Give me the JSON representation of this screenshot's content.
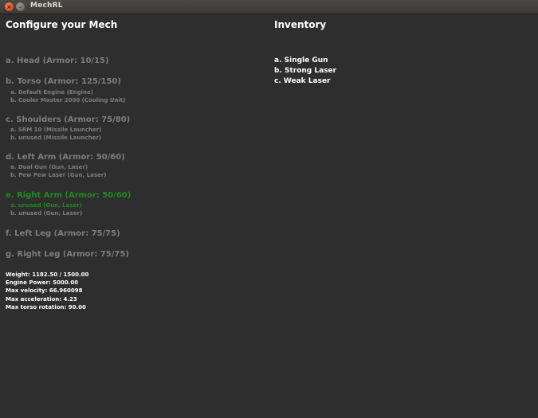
{
  "window": {
    "title": "MechRL",
    "close_glyph": "×",
    "minimize_glyph": "–"
  },
  "config": {
    "heading": "Configure your Mech",
    "parts": [
      {
        "label": "a. Head (Armor: 10/15)",
        "slots": []
      },
      {
        "label": "b. Torso (Armor: 125/150)",
        "slots": [
          "a. Default Engine (Engine)",
          "b. Cooler Master 2000 (Cooling Unit)"
        ]
      },
      {
        "label": "c. Shoulders (Armor: 75/80)",
        "slots": [
          "a. SRM 10 (Missile Launcher)",
          "b. unused (Missile Launcher)"
        ]
      },
      {
        "label": "d. Left Arm (Armor: 50/60)",
        "slots": [
          "a. Dual Gun (Gun, Laser)",
          "b. Pew Pew Laser (Gun, Laser)"
        ]
      },
      {
        "label": "e. Right Arm (Armor: 50/60)",
        "slots": [
          "a. unused (Gun, Laser)",
          "b. unused (Gun, Laser)"
        ]
      },
      {
        "label": "f. Left Leg (Armor: 75/75)",
        "slots": []
      },
      {
        "label": "g. Right Leg (Armor: 75/75)",
        "slots": []
      }
    ],
    "stats": [
      "Weight: 1182.50 / 1500.00",
      "Engine Power: 5000.00",
      "Max velocity: 66.960098",
      "Max acceleration: 4.23",
      "Max torso rotation: 90.00"
    ]
  },
  "inventory": {
    "heading": "Inventory",
    "items": [
      "a. Single Gun",
      "b. Strong Laser",
      "c. Weak Laser"
    ]
  },
  "colors": {
    "background": "#2e2e2e",
    "text_active": "#ffffff",
    "text_dim": "#7d7d7d",
    "text_selected": "#1d8a1d"
  }
}
